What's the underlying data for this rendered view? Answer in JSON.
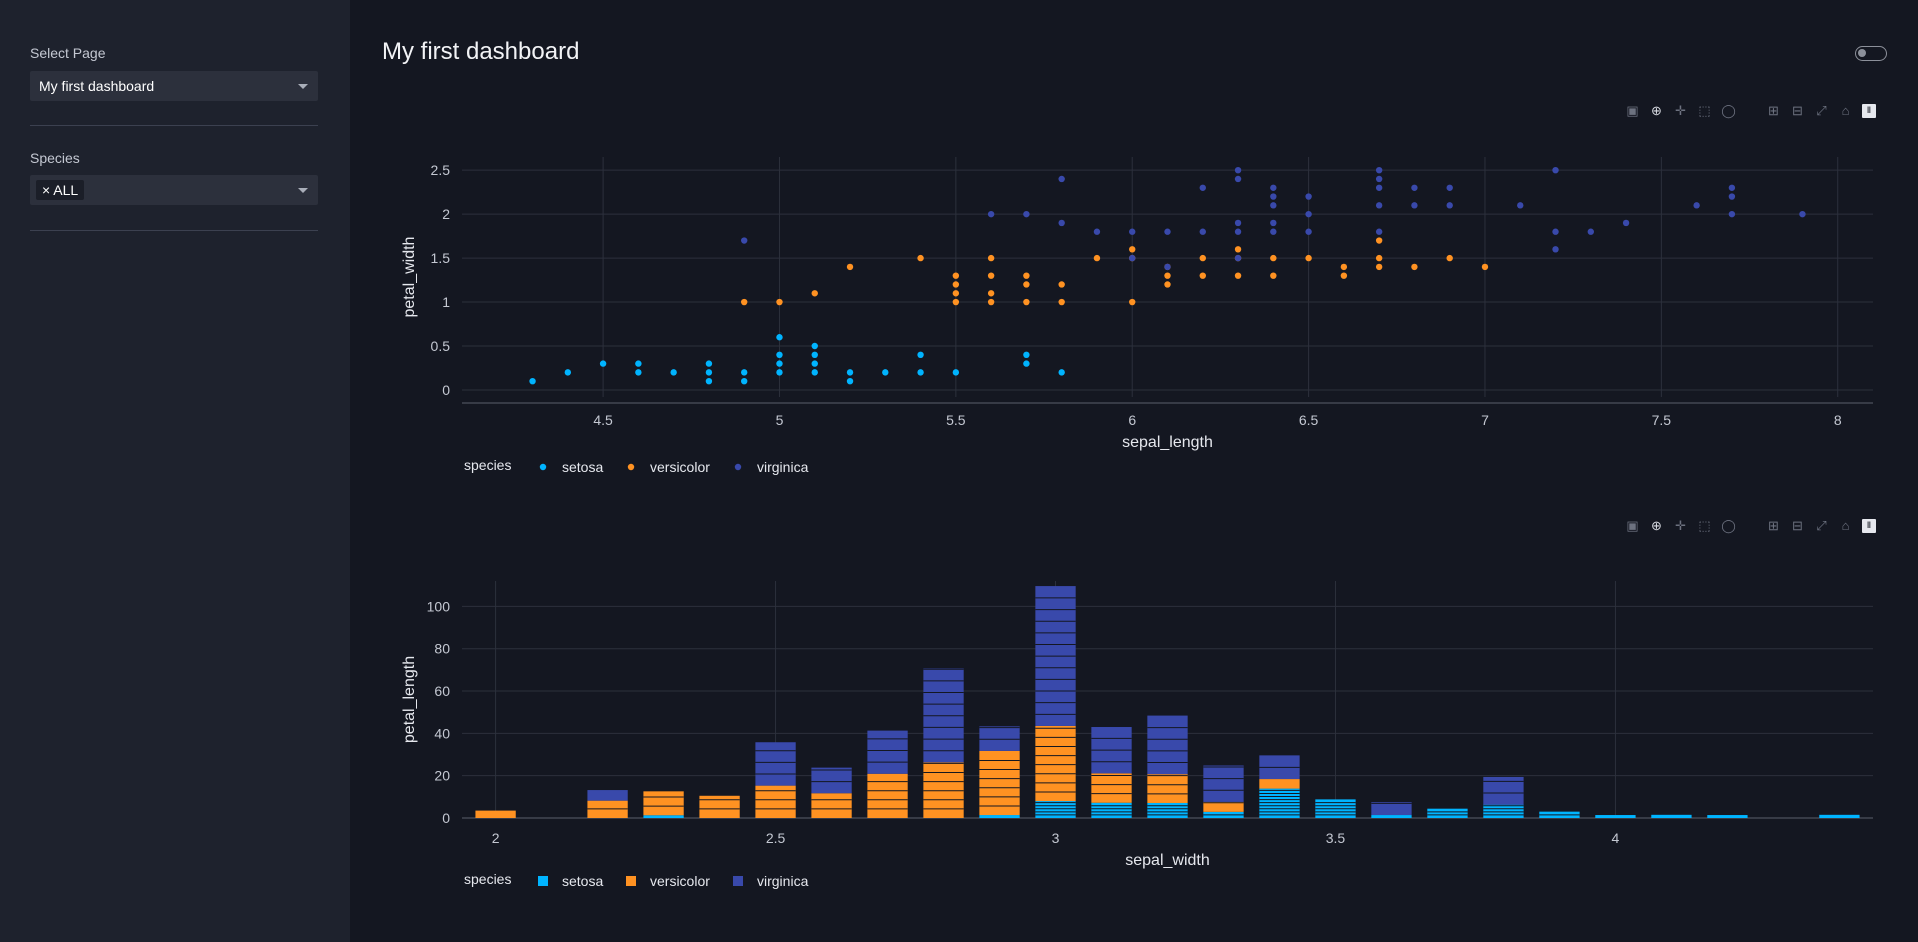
{
  "sidebar": {
    "page_label": "Select Page",
    "page_value": "My first dashboard",
    "species_label": "Species",
    "species_chip": "× ALL"
  },
  "header": {
    "title": "My first dashboard"
  },
  "colors": {
    "setosa": "#00b4ff",
    "versicolor": "#ff9222",
    "virginica": "#3949ab",
    "grid": "#2c303c",
    "text": "#c4c8d2"
  },
  "modebar_icons": [
    "camera-icon",
    "zoom-icon",
    "pan-icon",
    "box-select-icon",
    "lasso-icon",
    "zoom-in-icon",
    "zoom-out-icon",
    "autoscale-icon",
    "reset-axes-icon",
    "plotly-logo-icon"
  ],
  "chart_data": [
    {
      "type": "scatter",
      "xlabel": "sepal_length",
      "ylabel": "petal_width",
      "xlim": [
        4.1,
        8.1
      ],
      "ylim": [
        -0.08,
        2.65
      ],
      "xticks": [
        4.5,
        5,
        5.5,
        6,
        6.5,
        7,
        7.5,
        8
      ],
      "yticks": [
        0,
        0.5,
        1,
        1.5,
        2,
        2.5
      ],
      "xtick_labels": [
        "4.5",
        "5",
        "5.5",
        "6",
        "6.5",
        "7",
        "7.5",
        "8"
      ],
      "ytick_labels": [
        "0",
        "0.5",
        "1",
        "1.5",
        "2",
        "2.5"
      ],
      "legend_title": "species",
      "series": [
        {
          "name": "setosa",
          "points": [
            [
              4.3,
              0.1
            ],
            [
              4.4,
              0.2
            ],
            [
              4.5,
              0.3
            ],
            [
              4.6,
              0.2
            ],
            [
              4.6,
              0.3
            ],
            [
              4.7,
              0.2
            ],
            [
              4.8,
              0.1
            ],
            [
              4.8,
              0.2
            ],
            [
              4.8,
              0.3
            ],
            [
              4.9,
              0.1
            ],
            [
              4.9,
              0.2
            ],
            [
              5.0,
              0.2
            ],
            [
              5.0,
              0.3
            ],
            [
              5.0,
              0.4
            ],
            [
              5.0,
              0.6
            ],
            [
              5.1,
              0.2
            ],
            [
              5.1,
              0.3
            ],
            [
              5.1,
              0.4
            ],
            [
              5.1,
              0.5
            ],
            [
              5.2,
              0.1
            ],
            [
              5.2,
              0.2
            ],
            [
              5.3,
              0.2
            ],
            [
              5.4,
              0.2
            ],
            [
              5.4,
              0.4
            ],
            [
              5.5,
              0.2
            ],
            [
              5.7,
              0.3
            ],
            [
              5.7,
              0.4
            ],
            [
              5.8,
              0.2
            ]
          ]
        },
        {
          "name": "versicolor",
          "points": [
            [
              4.9,
              1.0
            ],
            [
              5.0,
              1.0
            ],
            [
              5.1,
              1.1
            ],
            [
              5.2,
              1.4
            ],
            [
              5.4,
              1.5
            ],
            [
              5.5,
              1.0
            ],
            [
              5.5,
              1.1
            ],
            [
              5.5,
              1.2
            ],
            [
              5.5,
              1.3
            ],
            [
              5.6,
              1.0
            ],
            [
              5.6,
              1.1
            ],
            [
              5.6,
              1.3
            ],
            [
              5.6,
              1.5
            ],
            [
              5.7,
              1.0
            ],
            [
              5.7,
              1.2
            ],
            [
              5.7,
              1.3
            ],
            [
              5.8,
              1.0
            ],
            [
              5.8,
              1.2
            ],
            [
              5.9,
              1.5
            ],
            [
              6.0,
              1.0
            ],
            [
              6.0,
              1.5
            ],
            [
              6.0,
              1.6
            ],
            [
              6.1,
              1.2
            ],
            [
              6.1,
              1.3
            ],
            [
              6.1,
              1.4
            ],
            [
              6.2,
              1.3
            ],
            [
              6.2,
              1.5
            ],
            [
              6.3,
              1.3
            ],
            [
              6.3,
              1.5
            ],
            [
              6.3,
              1.6
            ],
            [
              6.4,
              1.3
            ],
            [
              6.4,
              1.5
            ],
            [
              6.5,
              1.5
            ],
            [
              6.6,
              1.3
            ],
            [
              6.6,
              1.4
            ],
            [
              6.7,
              1.4
            ],
            [
              6.7,
              1.5
            ],
            [
              6.7,
              1.7
            ],
            [
              6.8,
              1.4
            ],
            [
              6.9,
              1.5
            ],
            [
              7.0,
              1.4
            ]
          ]
        },
        {
          "name": "virginica",
          "points": [
            [
              4.9,
              1.7
            ],
            [
              5.6,
              2.0
            ],
            [
              5.7,
              2.0
            ],
            [
              5.8,
              1.9
            ],
            [
              5.8,
              2.4
            ],
            [
              5.9,
              1.8
            ],
            [
              6.0,
              1.5
            ],
            [
              6.0,
              1.8
            ],
            [
              6.1,
              1.4
            ],
            [
              6.1,
              1.8
            ],
            [
              6.2,
              1.8
            ],
            [
              6.2,
              2.3
            ],
            [
              6.3,
              1.5
            ],
            [
              6.3,
              1.8
            ],
            [
              6.3,
              1.9
            ],
            [
              6.3,
              2.4
            ],
            [
              6.3,
              2.5
            ],
            [
              6.4,
              1.8
            ],
            [
              6.4,
              1.9
            ],
            [
              6.4,
              2.1
            ],
            [
              6.4,
              2.2
            ],
            [
              6.4,
              2.3
            ],
            [
              6.5,
              1.8
            ],
            [
              6.5,
              2.0
            ],
            [
              6.5,
              2.2
            ],
            [
              6.7,
              1.8
            ],
            [
              6.7,
              2.1
            ],
            [
              6.7,
              2.3
            ],
            [
              6.7,
              2.4
            ],
            [
              6.7,
              2.5
            ],
            [
              6.8,
              2.1
            ],
            [
              6.8,
              2.3
            ],
            [
              6.9,
              2.1
            ],
            [
              6.9,
              2.3
            ],
            [
              7.1,
              2.1
            ],
            [
              7.2,
              1.6
            ],
            [
              7.2,
              1.8
            ],
            [
              7.2,
              2.5
            ],
            [
              7.3,
              1.8
            ],
            [
              7.4,
              1.9
            ],
            [
              7.6,
              2.1
            ],
            [
              7.7,
              2.0
            ],
            [
              7.7,
              2.2
            ],
            [
              7.7,
              2.3
            ],
            [
              7.9,
              2.0
            ]
          ]
        }
      ]
    },
    {
      "type": "bar",
      "barmode": "stack",
      "xlabel": "sepal_width",
      "ylabel": "petal_length",
      "xlim": [
        1.94,
        4.46
      ],
      "ylim": [
        0,
        112
      ],
      "xticks": [
        2,
        2.5,
        3,
        3.5,
        4
      ],
      "yticks": [
        0,
        20,
        40,
        60,
        80,
        100
      ],
      "xtick_labels": [
        "2",
        "2.5",
        "3",
        "3.5",
        "4"
      ],
      "ytick_labels": [
        "0",
        "20",
        "40",
        "60",
        "80",
        "100"
      ],
      "legend_title": "species",
      "categories": [
        2.0,
        2.2,
        2.3,
        2.4,
        2.5,
        2.6,
        2.7,
        2.8,
        2.9,
        3.0,
        3.1,
        3.2,
        3.3,
        3.4,
        3.5,
        3.6,
        3.7,
        3.8,
        3.9,
        4.0,
        4.1,
        4.2,
        4.4
      ],
      "series": [
        {
          "name": "setosa",
          "values": [
            0,
            0,
            1.3,
            0,
            0,
            0,
            0,
            0,
            1.4,
            8.0,
            7.2,
            7.1,
            2.9,
            13.9,
            8.8,
            1.4,
            4.4,
            6.3,
            3.0,
            1.4,
            1.5,
            1.4,
            1.5
          ]
        },
        {
          "name": "versicolor",
          "values": [
            3.5,
            8.2,
            11.3,
            10.5,
            15.3,
            11.7,
            20.9,
            26.3,
            30.3,
            35.5,
            13.9,
            13.6,
            4.7,
            4.5,
            0,
            0,
            0,
            0,
            0,
            0,
            0,
            0,
            0
          ]
        },
        {
          "name": "virginica",
          "values": [
            0,
            5.0,
            0,
            0,
            20.5,
            12.1,
            20.4,
            44.4,
            11.6,
            66.1,
            21.9,
            27.7,
            17.2,
            11.2,
            0,
            6.1,
            0,
            13.1,
            0,
            0,
            0,
            0,
            0
          ]
        }
      ]
    }
  ]
}
